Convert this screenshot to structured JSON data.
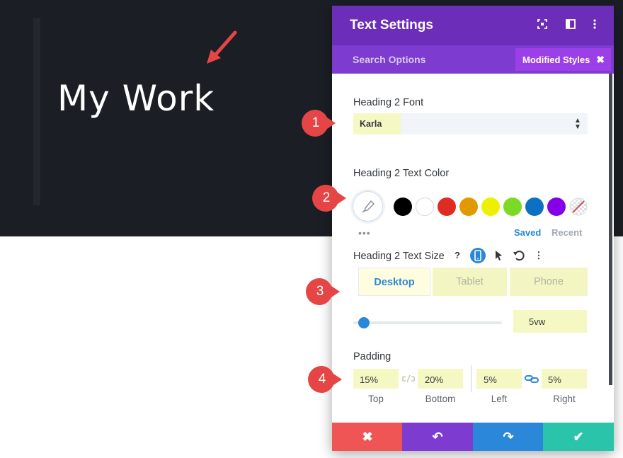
{
  "preview": {
    "heading": "My Work"
  },
  "panel": {
    "title": "Text Settings",
    "search_label": "Search Options",
    "modified_label": "Modified Styles",
    "font_label": "Heading 2 Font",
    "font_value": "Karla",
    "color_label": "Heading 2 Text Color",
    "swatches": [
      "#000000",
      "#ffffff",
      "#e02b20",
      "#e09900",
      "#edf000",
      "#7cda24",
      "#0c71c3",
      "#8300e9"
    ],
    "more_dots": "•••",
    "saved_label": "Saved",
    "recent_label": "Recent",
    "size_label": "Heading 2 Text Size",
    "help_glyph": "?",
    "more_glyph": "⋮",
    "device_tabs": [
      "Desktop",
      "Tablet",
      "Phone"
    ],
    "size_value": "5vw",
    "padding_label": "Padding",
    "padding": {
      "top": {
        "value": "15%",
        "label": "Top"
      },
      "bottom": {
        "value": "20%",
        "label": "Bottom"
      },
      "left": {
        "value": "5%",
        "label": "Left"
      },
      "right": {
        "value": "5%",
        "label": "Right"
      }
    },
    "footer": {
      "cancel_glyph": "✖",
      "undo_glyph": "↶",
      "redo_glyph": "↷",
      "save_glyph": "✔",
      "cancel_color": "#ef5555",
      "undo_color": "#7e3bd0",
      "redo_color": "#2b87da",
      "save_color": "#29c4a9"
    }
  },
  "callouts": [
    "1",
    "2",
    "3",
    "4"
  ],
  "colors": {
    "header": "#6c2eb9",
    "subheader": "#7d3bcf",
    "accent": "#2b87da",
    "callout": "#e64545",
    "highlight": "#f6f8c4"
  }
}
